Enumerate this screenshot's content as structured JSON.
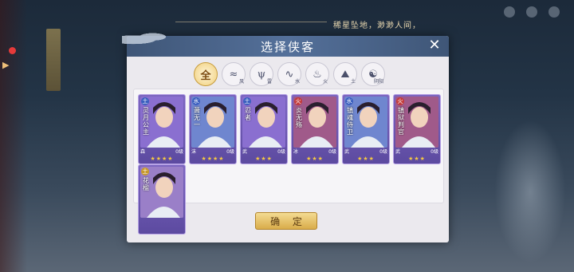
{
  "hud": {
    "hint_text": "稀星坠地，渺渺人间，"
  },
  "dialog": {
    "title": "选择侠客",
    "close_label": "✕",
    "confirm_label": "确 定"
  },
  "filters": [
    {
      "glyph": "全",
      "sub": "",
      "active": true
    },
    {
      "glyph": "≈",
      "sub": "风",
      "active": false
    },
    {
      "glyph": "ψ",
      "sub": "雷",
      "active": false
    },
    {
      "glyph": "∿",
      "sub": "水",
      "active": false
    },
    {
      "glyph": "♨",
      "sub": "火",
      "active": false
    },
    {
      "glyph": "⛰",
      "sub": "土",
      "active": false
    },
    {
      "glyph": "☯",
      "sub": "阴阳",
      "active": false
    }
  ],
  "cards": [
    {
      "name": "灵月公主",
      "element": "土",
      "type": "森",
      "count": "0级",
      "stars": "★★★★",
      "tag_color": "purple"
    },
    {
      "name": "萧无一",
      "element": "水",
      "type": "沫",
      "count": "0级",
      "stars": "★★★★",
      "tag_color": "blue"
    },
    {
      "name": "忍者",
      "element": "土",
      "type": "武",
      "count": "0级",
      "stars": "★★★",
      "tag_color": "purple"
    },
    {
      "name": "炎无殇",
      "element": "火",
      "type": "冰",
      "count": "0级",
      "stars": "★★★",
      "tag_color": "red"
    },
    {
      "name": "镇魂侍卫",
      "element": "水",
      "type": "武",
      "count": "0级",
      "stars": "★★★",
      "tag_color": "blue"
    },
    {
      "name": "镇狱判官",
      "element": "火",
      "type": "武",
      "count": "0级",
      "stars": "★★★",
      "tag_color": "red"
    },
    {
      "name": "花楹",
      "element": "土",
      "type": "",
      "count": "",
      "stars": "",
      "tag_color": "gold"
    }
  ]
}
